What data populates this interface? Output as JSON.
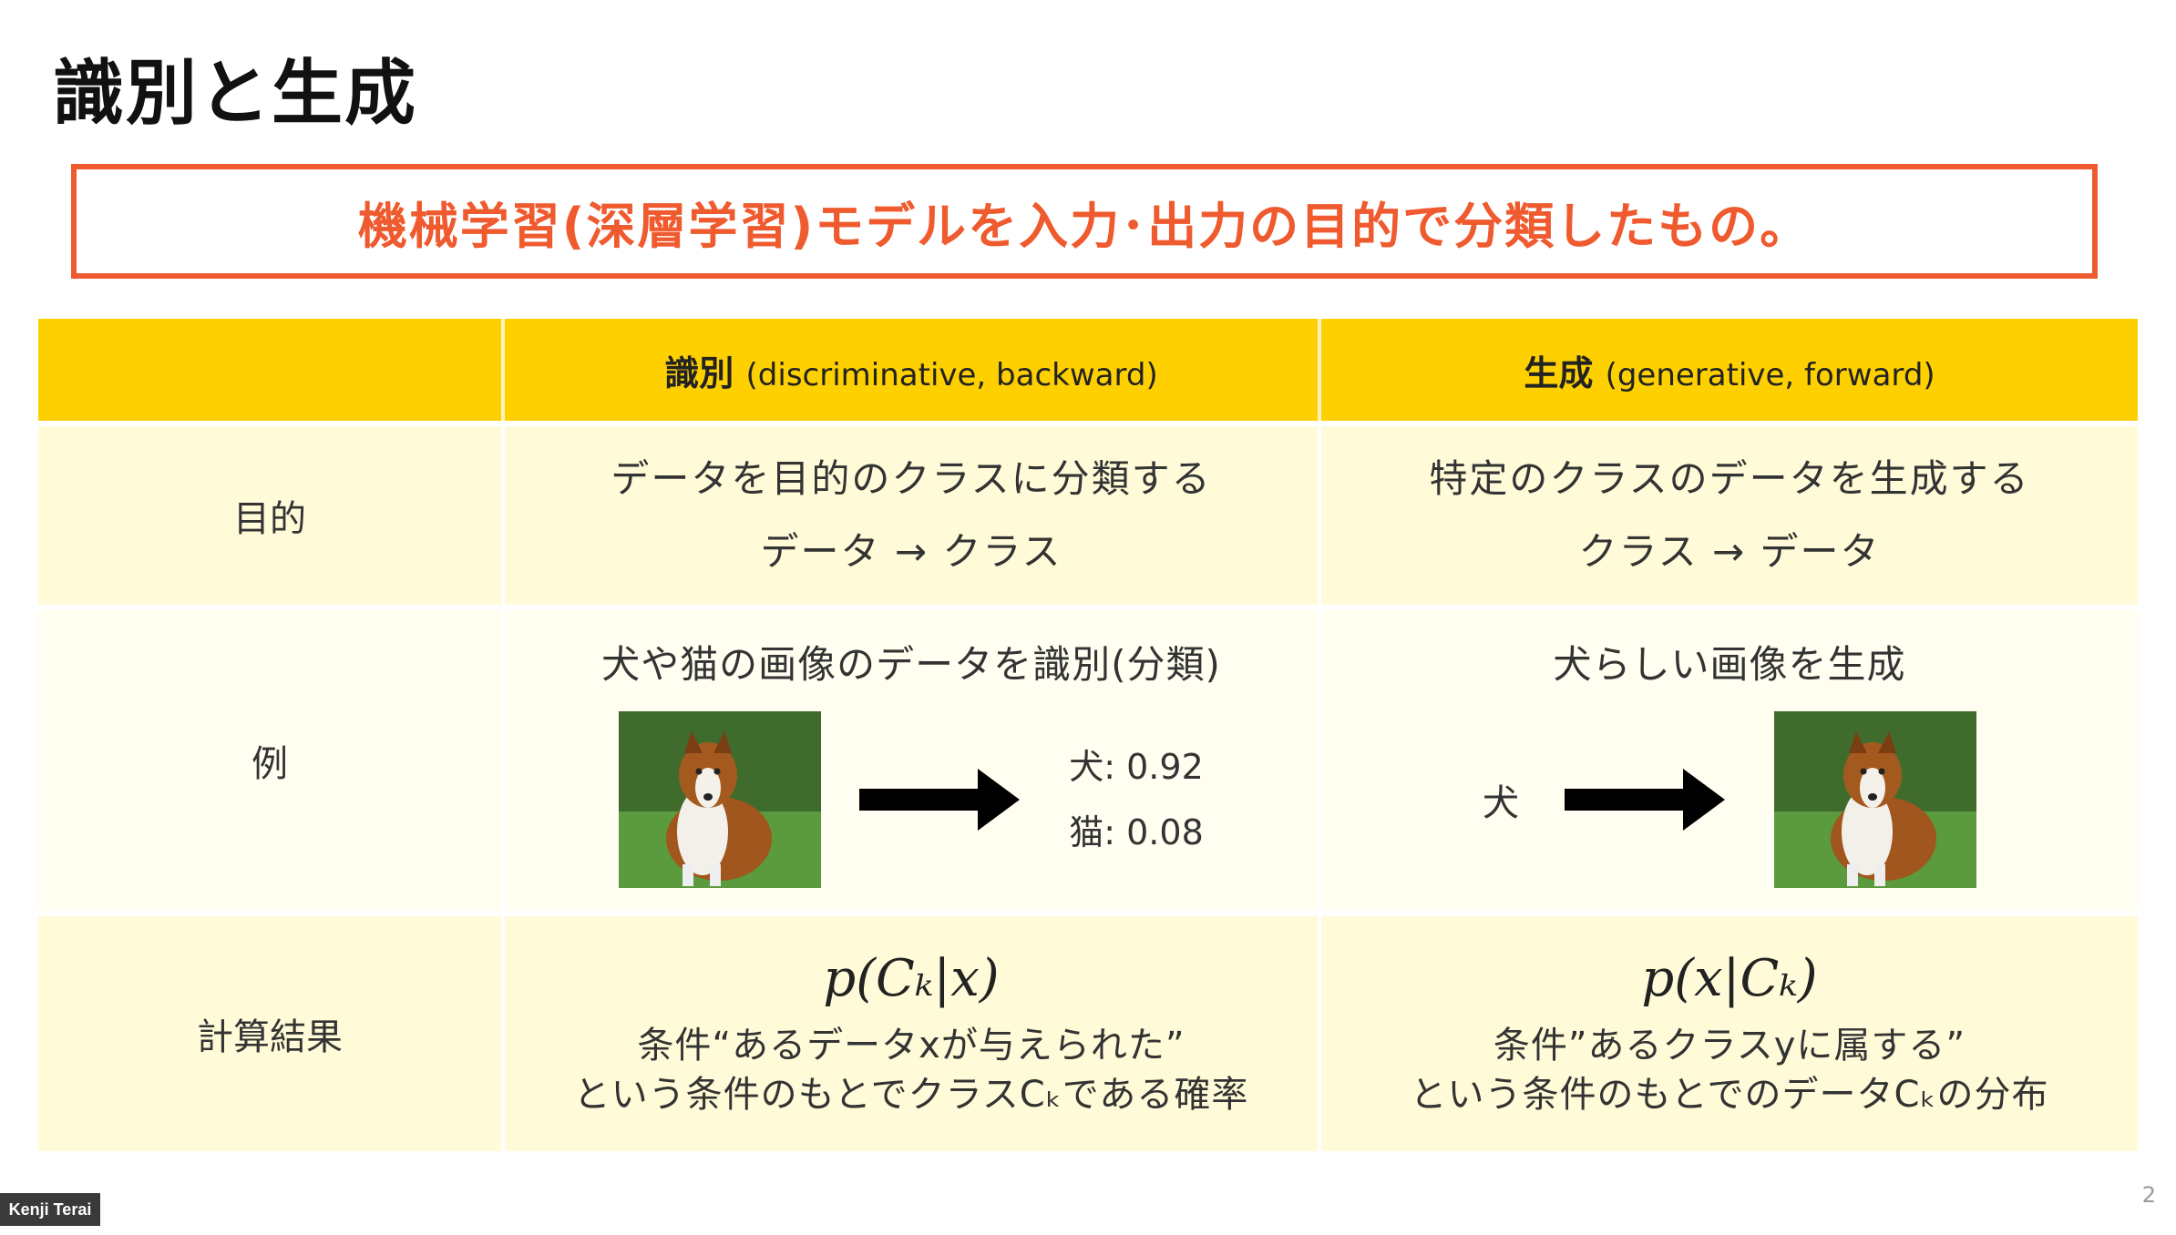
{
  "slide": {
    "title": "識別と生成",
    "subtitle": "機械学習(深層学習)モデルを入力･出力の目的で分類したもの。",
    "page_number": "2"
  },
  "table": {
    "header": {
      "disc_jp": "識別",
      "disc_en": "(discriminative, backward)",
      "gen_jp": "生成",
      "gen_en": "(generative, forward)"
    },
    "purpose": {
      "label": "目的",
      "disc_line1": "データを目的のクラスに分類する",
      "disc_line2": "データ → クラス",
      "gen_line1": "特定のクラスのデータを生成する",
      "gen_line2": "クラス → データ"
    },
    "example": {
      "label": "例",
      "disc_title": "犬や猫の画像のデータを識別(分類)",
      "disc_prob_dog": "犬: 0.92",
      "disc_prob_cat": "猫: 0.08",
      "gen_title": "犬らしい画像を生成",
      "gen_input": "犬"
    },
    "result": {
      "label": "計算結果",
      "disc_formula": "p(Cₖ|x)",
      "disc_desc1": "条件“あるデータxが与えられた”",
      "disc_desc2": "という条件のもとでクラスCₖである確率",
      "gen_formula": "p(x|Cₖ)",
      "gen_desc1": "条件”あるクラスyに属する”",
      "gen_desc2": "という条件のもとでのデータCₖの分布"
    }
  },
  "presenter": "Kenji Terai",
  "colors": {
    "accent_orange": "#ef5a2e",
    "header_yellow": "#ffd000",
    "row_light": "#fffbd8",
    "row_lighter": "#fffef0"
  },
  "icons": [
    "dog-photo",
    "right-arrow-icon"
  ]
}
